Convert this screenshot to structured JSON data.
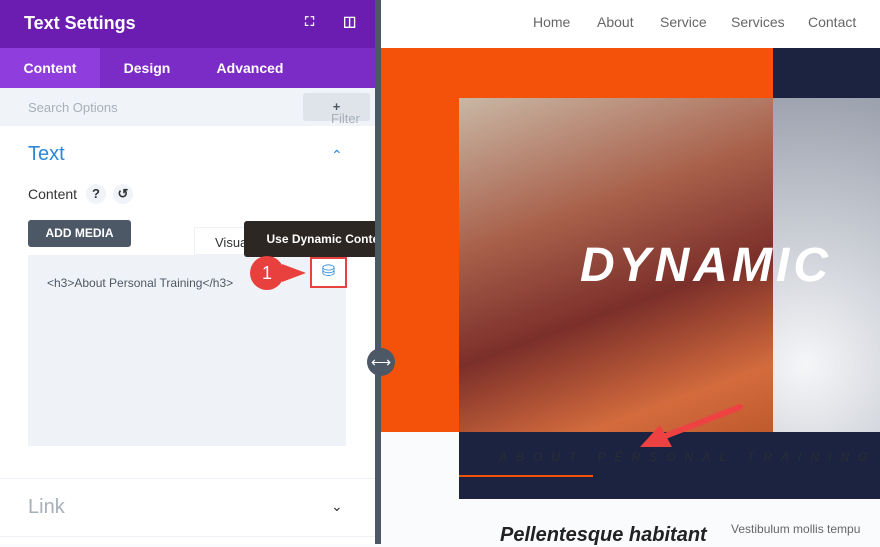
{
  "panel": {
    "title": "Text Settings",
    "tabs": [
      "Content",
      "Design",
      "Advanced"
    ],
    "search_placeholder": "Search Options",
    "filter_label": "Filter",
    "text_section": "Text",
    "content_label": "Content",
    "help": "?",
    "add_media": "ADD MEDIA",
    "visual_tab": "Visual",
    "content_value": "<h3>About Personal Training</h3>",
    "tooltip": "Use Dynamic Content",
    "link_section": "Link"
  },
  "annotation": {
    "step": "1"
  },
  "site": {
    "nav": [
      "Home",
      "About",
      "Service",
      "Services",
      "Contact"
    ],
    "hero_text": "DYNAMIC",
    "band_text": "ABOUT PERSONAL TRAINING",
    "heading": "Pellentesque habitant",
    "body": "Vestibulum mollis tempu"
  },
  "colors": {
    "purple": "#6c1db1",
    "orange": "#f4510b",
    "navy": "#1b2340",
    "blue": "#2b87da"
  }
}
